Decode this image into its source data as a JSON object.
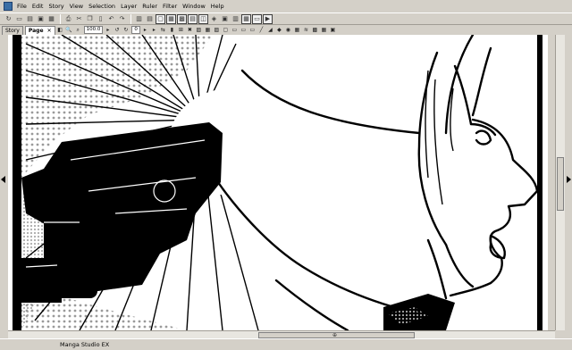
{
  "menubar": {
    "items": [
      "File",
      "Edit",
      "Story",
      "View",
      "Selection",
      "Layer",
      "Ruler",
      "Filter",
      "Window",
      "Help"
    ]
  },
  "tabs": {
    "story_label": "Story",
    "page_label": "Page",
    "page_close": "✕"
  },
  "page_controls": {
    "zoom_value": "100.0",
    "rotation_value": "0"
  },
  "status": {
    "app_name": "Manga Studio EX"
  },
  "icons": {
    "menu_app": "app-icon",
    "toolbar1": [
      "new-file-icon",
      "open-folder-icon",
      "open-story-icon",
      "save-icon",
      "save-as-icon",
      "print-icon",
      "cut-icon",
      "copy-icon",
      "paste-icon",
      "undo-icon",
      "redo-icon",
      "print-preview-icon",
      "view-mode-icon",
      "page-layout-icon",
      "spread-icon",
      "grid-icon",
      "ruler-icon",
      "perspective-icon",
      "layer-icon",
      "frame-icon",
      "tone-icon",
      "render-icon",
      "screen-icon",
      "play-icon"
    ],
    "toolbar2": [
      "page-prev-icon",
      "zoom-in-icon",
      "zoom-out-icon",
      "fit-page-icon",
      "rotate-left-icon",
      "rotate-right-icon",
      "forward-icon",
      "back-icon",
      "selection-icon",
      "transform-icon",
      "grid-icon",
      "layer-icon",
      "stamp-icon",
      "pen-icon",
      "brush-icon",
      "fill-icon",
      "eraser-icon",
      "gradient-icon",
      "tone-icon",
      "ruler-icon",
      "text-icon",
      "balloon-icon",
      "frame-icon",
      "settings-icon"
    ]
  },
  "colors": {
    "chrome": "#d4d0c8",
    "ink": "#000000",
    "paper": "#ffffff",
    "screentone": "#9a9a9a"
  }
}
